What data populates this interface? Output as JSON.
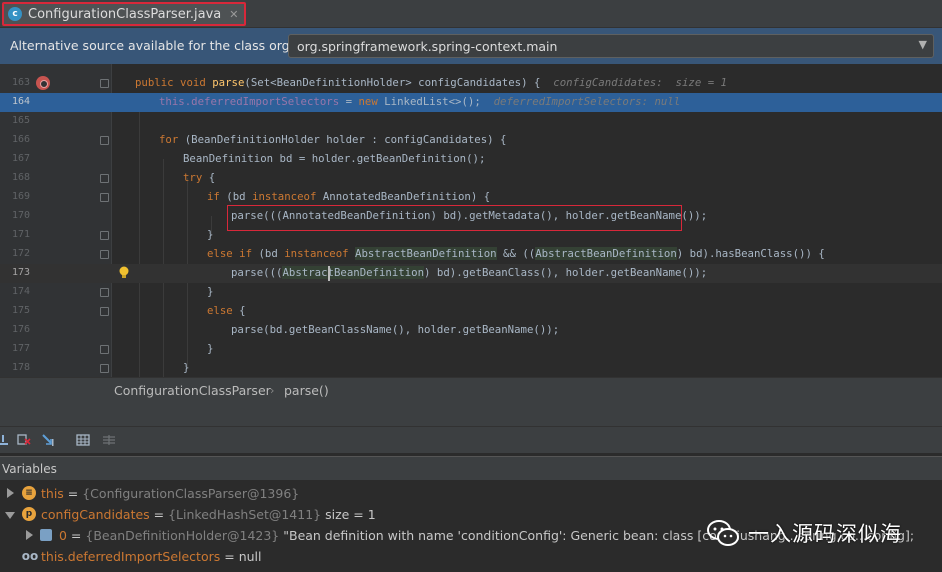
{
  "tab": {
    "title": "ConfigurationClassParser.java",
    "icon": "class-file-icon"
  },
  "notice": {
    "text": "Alternative source available for the class org....",
    "selected": "org.springframework.spring-context.main"
  },
  "editor": {
    "line_numbers": [
      "163",
      "164",
      "165",
      "166",
      "167",
      "168",
      "169",
      "170",
      "171",
      "172",
      "173",
      "174",
      "175",
      "176",
      "177",
      "178"
    ],
    "lines": {
      "l163": {
        "kw1": "public void ",
        "fn": "parse",
        "rest": "(Set<BeanDefinitionHolder> configCandidates) {",
        "hint": "configCandidates:  size = 1"
      },
      "l164": {
        "fld": "this.deferredImportSelectors",
        "eq": " = ",
        "kw": "new",
        "rest": " LinkedList<>();",
        "hint": "deferredImportSelectors: null"
      },
      "l166": {
        "kw": "for",
        "rest": " (BeanDefinitionHolder holder : configCandidates) {"
      },
      "l167": {
        "rest": "BeanDefinition bd = holder.getBeanDefinition();"
      },
      "l168": {
        "kw": "try",
        "rest": " {"
      },
      "l169": {
        "kw": "if",
        "mid": " (bd ",
        "kw2": "instanceof",
        "rest": " AnnotatedBeanDefinition) {"
      },
      "l170": {
        "rest": "parse(((AnnotatedBeanDefinition) bd).getMetadata(), holder.getBeanName());"
      },
      "l171": {
        "rest": "}"
      },
      "l172": {
        "kw": "else if",
        "mid": " (bd ",
        "kw2": "instanceof",
        "sp": " ",
        "hl1": "AbstractBeanDefinition",
        "mid2": " && ((",
        "hl2": "AbstractBeanDefinition",
        "rest": ") bd).hasBeanClass()) {"
      },
      "l173": {
        "pre": "parse(((",
        "hl": "AbstractBeanDefinition",
        "rest": ") bd).getBeanClass(), holder.getBeanName());"
      },
      "l174": {
        "rest": "}"
      },
      "l175": {
        "kw": "else",
        "rest": " {"
      },
      "l176": {
        "rest": "parse(bd.getBeanClassName(), holder.getBeanName());"
      },
      "l177": {
        "rest": "}"
      },
      "l178": {
        "rest": "}"
      }
    }
  },
  "breadcrumb": {
    "class": "ConfigurationClassParser",
    "sep": "›",
    "method": "parse()"
  },
  "debug_toolbar": {
    "icons": [
      "step-out-icon",
      "drop-frame-icon",
      "run-to-cursor-icon",
      "table-view-icon",
      "columns-icon"
    ]
  },
  "variables": {
    "title": "Variables",
    "rows": [
      {
        "name": "this",
        "eq": " = ",
        "value": "{ConfigurationClassParser@1396}",
        "icon": "field-icon"
      },
      {
        "name": "configCandidates",
        "eq": " = ",
        "value": "{LinkedHashSet@1411}",
        "extra": "  size = 1",
        "icon": "parameter-icon",
        "icon_letter": "p"
      },
      {
        "name": "0",
        "eq": " = ",
        "value": "{BeanDefinitionHolder@1423}",
        "extra": " \"Bean definition with name 'conditionConfig': Generic bean: class [com.liushang...spring.co...config];",
        "icon": "list-icon"
      },
      {
        "name": "this.deferredImportSelectors",
        "eq": " = ",
        "value": "null",
        "icon": "watch-icon",
        "icon_glyph": "oo"
      }
    ]
  },
  "watermark": {
    "text": "一入源码深似海"
  },
  "colors": {
    "accent": "#2d6099",
    "highlight_box": "#d8283a",
    "notice_bg": "#385678"
  }
}
